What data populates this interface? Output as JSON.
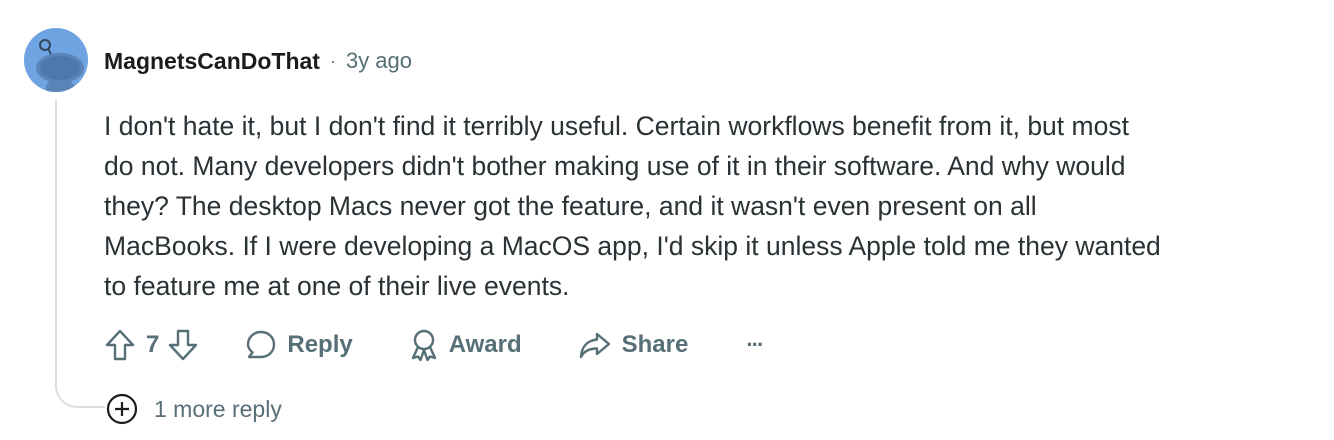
{
  "comment": {
    "author": "MagnetsCanDoThat",
    "separator": "·",
    "time_ago": "3y ago",
    "avatar_icon": "snoo-avatar-icon",
    "body_lines": [
      "I don't hate it, but I don't find it terribly useful. Certain workflows benefit from it, but most",
      "do not. Many developers didn't bother making use of it in their software. And why would",
      "they? The desktop Macs never got the feature, and it wasn't even present on all",
      "MacBooks. If I were developing a MacOS app, I'd skip it unless Apple told me they wanted",
      "to feature me at one of their live events."
    ]
  },
  "actions": {
    "upvote_icon": "upvote-arrow-icon",
    "vote_count": "7",
    "downvote_icon": "downvote-arrow-icon",
    "reply_label": "Reply",
    "award_label": "Award",
    "share_label": "Share",
    "more_label": "···"
  },
  "more_replies": {
    "icon": "plus-circle-icon",
    "label": "1 more reply"
  },
  "colors": {
    "meta_gray": "#576f76",
    "body_text": "#2a3236",
    "avatar_bg": "#6ea4e2",
    "thread_line": "#dadfe2"
  }
}
